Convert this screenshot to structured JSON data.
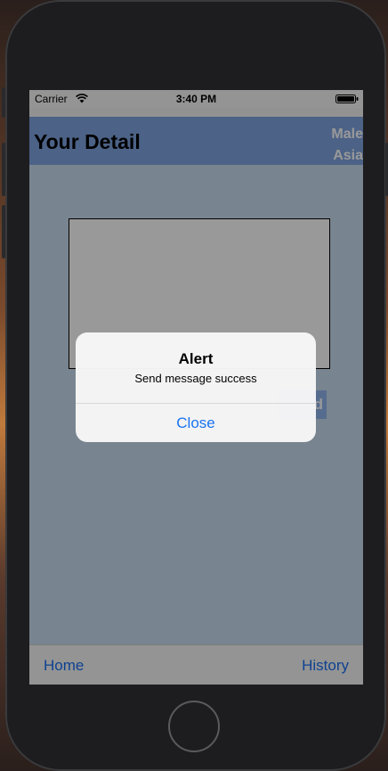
{
  "status_bar": {
    "carrier": "Carrier",
    "time": "3:40 PM",
    "wifi_icon": "wifi-icon",
    "battery_icon": "battery-icon"
  },
  "nav": {
    "title": "Your Detail",
    "gender": "Male",
    "region": "Asia"
  },
  "content": {
    "send_label": "d"
  },
  "tab_bar": {
    "home_label": "Home",
    "history_label": "History"
  },
  "alert": {
    "title": "Alert",
    "message": "Send message success",
    "close_label": "Close"
  },
  "colors": {
    "nav_background": "#7fa3e0",
    "tint": "#1a6ff0",
    "send_button": "#8fb4ee"
  }
}
